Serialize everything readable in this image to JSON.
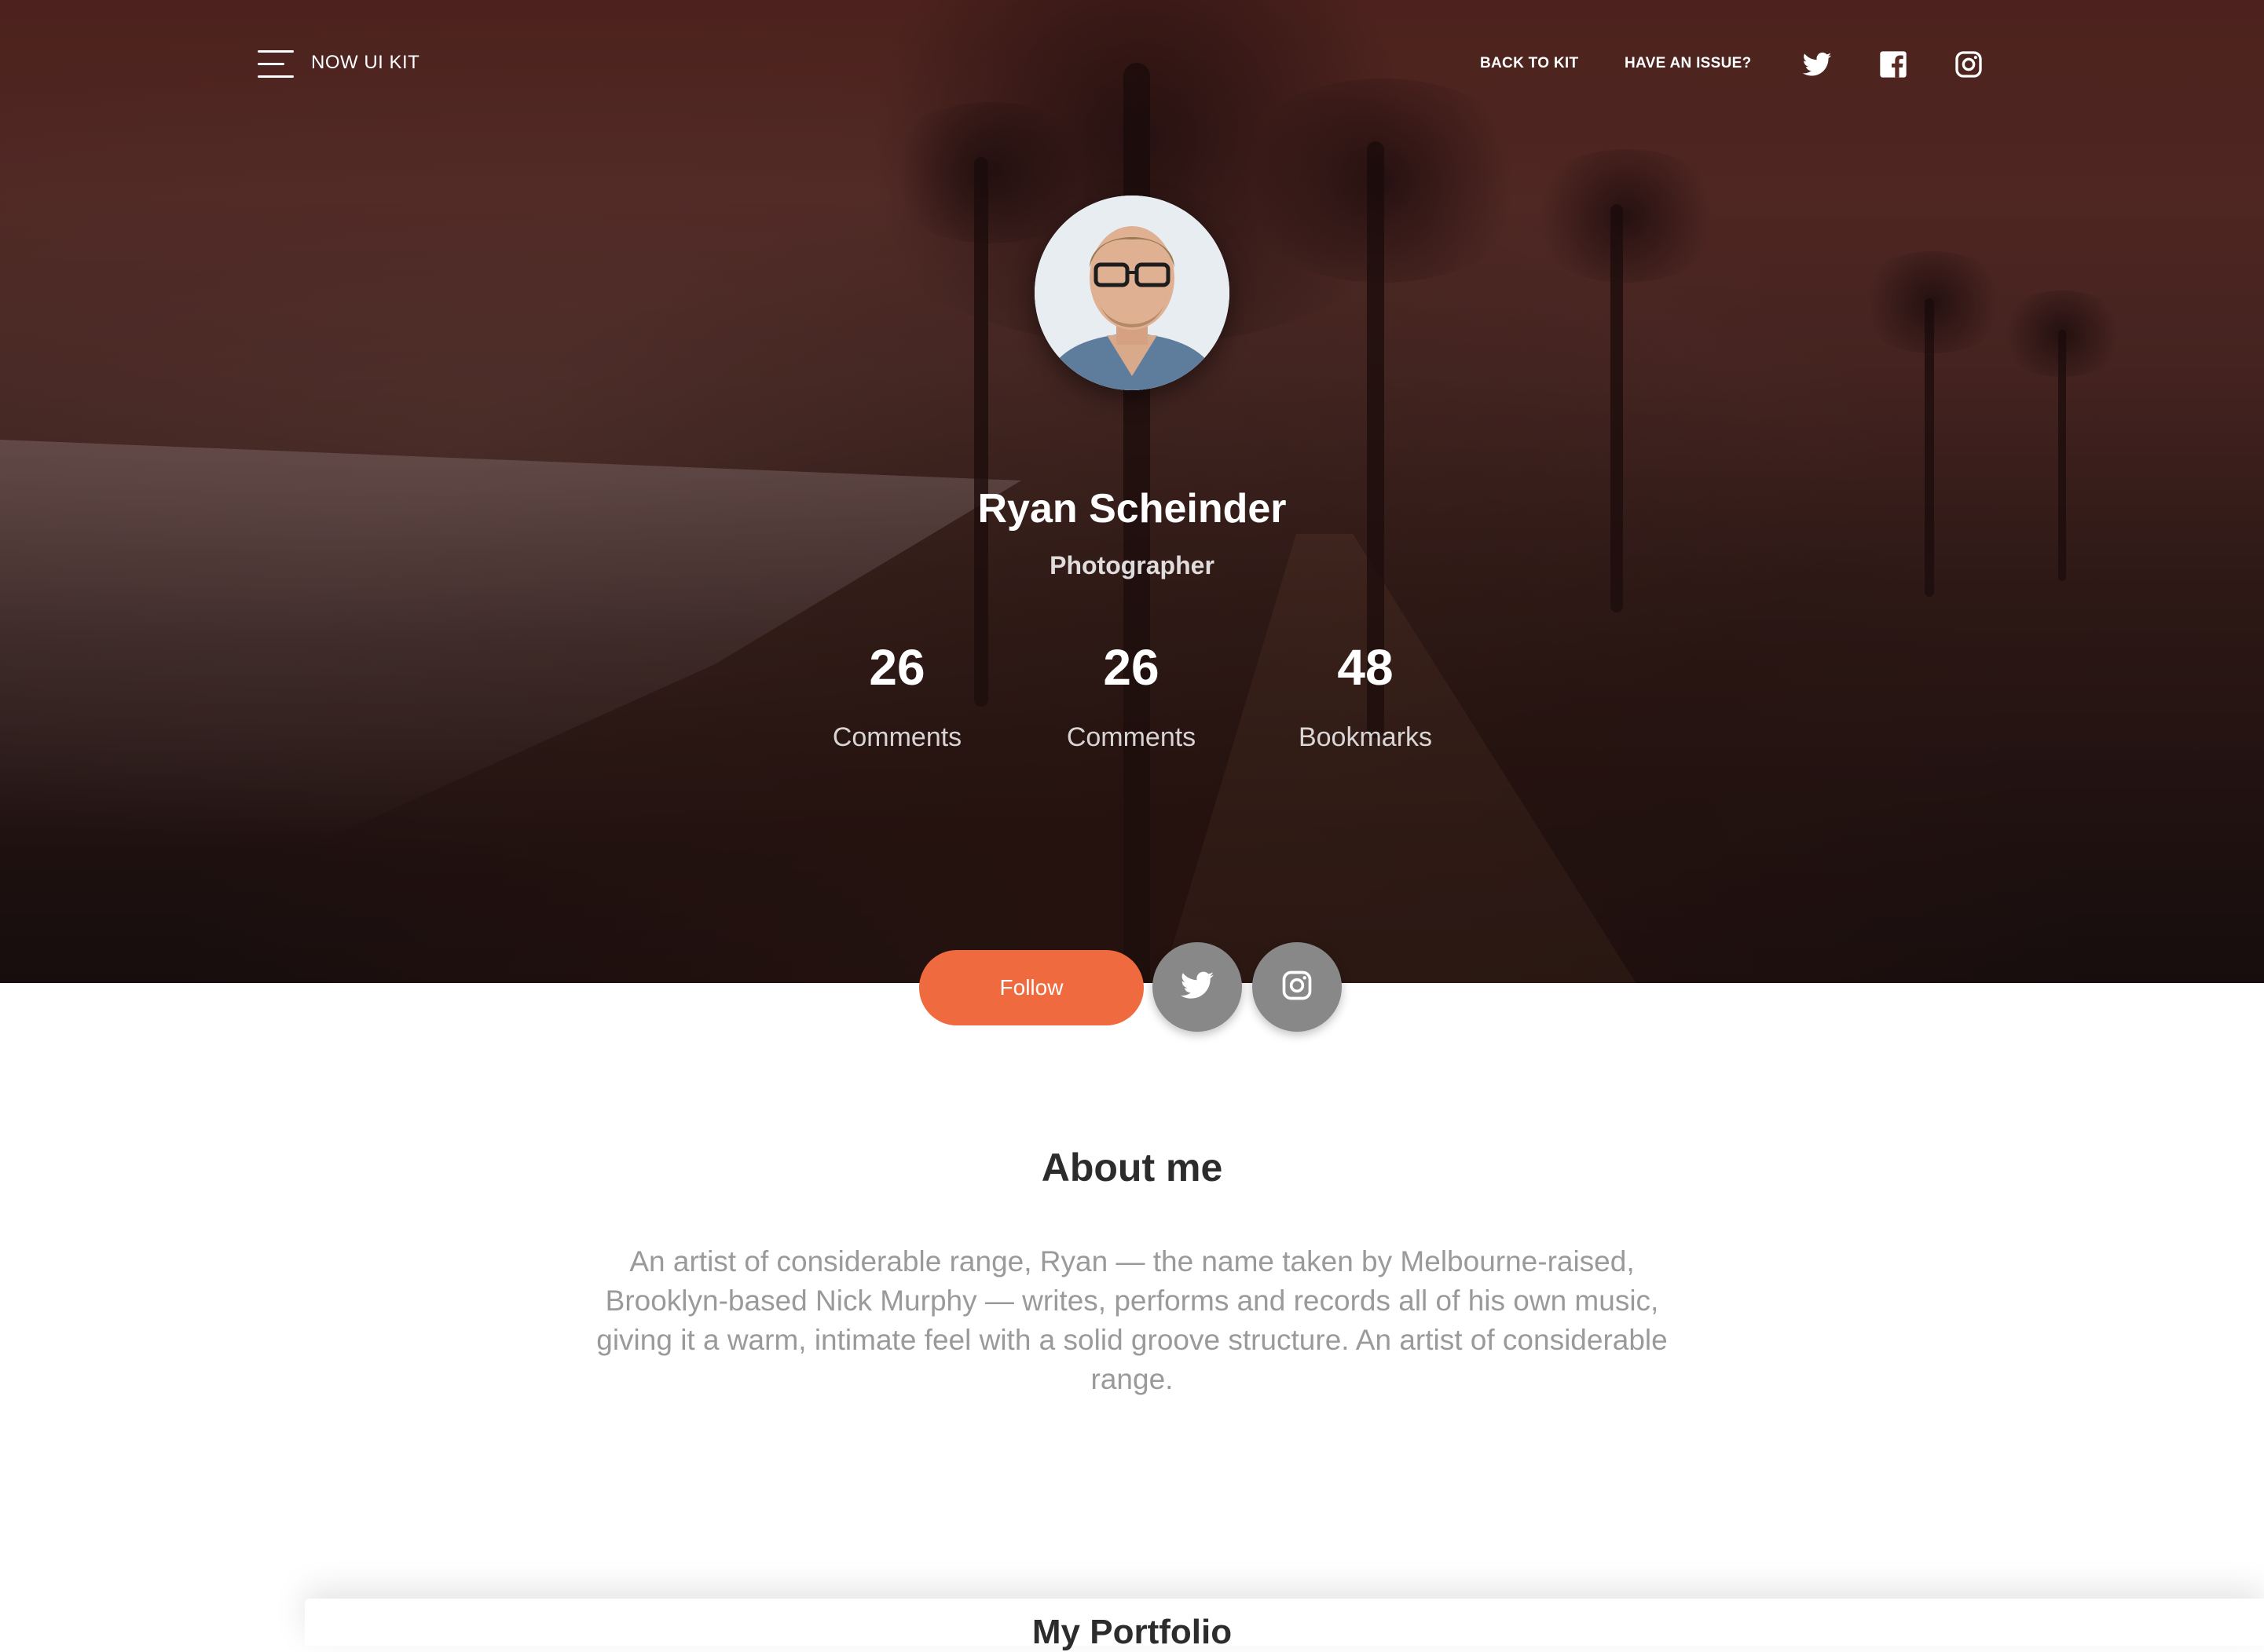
{
  "nav": {
    "brand": "NOW UI KIT",
    "links": [
      {
        "label": "BACK TO KIT"
      },
      {
        "label": "HAVE AN ISSUE?"
      }
    ],
    "icons": [
      "twitter-icon",
      "facebook-icon",
      "instagram-icon"
    ]
  },
  "profile": {
    "name": "Ryan Scheinder",
    "role": "Photographer",
    "stats": [
      {
        "value": "26",
        "label": "Comments"
      },
      {
        "value": "26",
        "label": "Comments"
      },
      {
        "value": "48",
        "label": "Bookmarks"
      }
    ]
  },
  "actions": {
    "follow_label": "Follow",
    "icons": [
      "twitter-icon",
      "instagram-icon"
    ]
  },
  "about": {
    "title": "About me",
    "text": "An artist of considerable range, Ryan — the name taken by Melbourne-raised, Brooklyn-based Nick Murphy — writes, performs and records all of his own music, giving it a warm, intimate feel with a solid groove structure. An artist of considerable range."
  },
  "portfolio": {
    "title": "My Portfolio"
  },
  "colors": {
    "accent": "#f06a3f",
    "round_button": "#888888",
    "heading": "#2c2c2c",
    "body_text": "#9a9a9a"
  }
}
